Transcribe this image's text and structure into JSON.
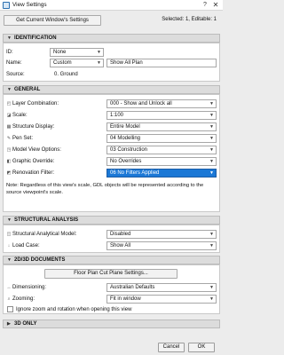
{
  "window": {
    "title": "View Settings",
    "help": "?",
    "close": "✕"
  },
  "top": {
    "get_button": "Get Current Window's Settings",
    "selection": "Selected: 1, Editable: 1"
  },
  "identification": {
    "header": "IDENTIFICATION",
    "id_label": "ID:",
    "id_value": "None",
    "name_label": "Name:",
    "name_mode": "Custom",
    "name_value": "Show All Plan",
    "source_label": "Source:",
    "source_value": "0. Ground"
  },
  "general": {
    "header": "GENERAL",
    "fields": [
      {
        "label": "Layer Combination:",
        "value": "000 - Show and Unlock all",
        "icon": "layers-icon"
      },
      {
        "label": "Scale:",
        "value": "1:100",
        "icon": "scale-icon"
      },
      {
        "label": "Structure Display:",
        "value": "Entire Model",
        "icon": "structure-icon"
      },
      {
        "label": "Pen Set:",
        "value": "04 Modelling",
        "icon": "pen-icon"
      },
      {
        "label": "Model View Options:",
        "value": "03 Construction",
        "icon": "model-view-icon"
      },
      {
        "label": "Graphic Override:",
        "value": "No Overrides",
        "icon": "override-icon"
      },
      {
        "label": "Renovation Filter:",
        "value": "06 No Filters Applied",
        "icon": "renovation-icon"
      }
    ],
    "note": "Note: Regardless of this view's scale, GDL objects will be represented according to the source viewpoint's scale."
  },
  "structural": {
    "header": "STRUCTURAL ANALYSIS",
    "model_label": "Structural Analytical Model:",
    "model_value": "Disabled",
    "load_label": "Load Case:",
    "load_value": "Show All"
  },
  "docs": {
    "header": "2D/3D DOCUMENTS",
    "cut_plane_button": "Floor Plan Cut Plane Settings...",
    "dim_label": "Dimensioning:",
    "dim_value": "Australian Defaults",
    "zoom_label": "Zooming:",
    "zoom_value": "Fit in window",
    "ignore_label": "Ignore zoom and rotation when opening this view"
  },
  "only3d": {
    "header": "3D ONLY"
  },
  "footer": {
    "cancel": "Cancel",
    "ok": "OK"
  }
}
